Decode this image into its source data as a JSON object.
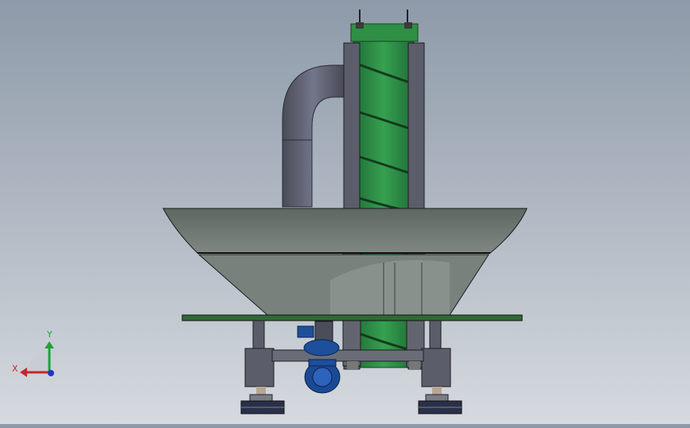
{
  "viewport": {
    "name": "3D model view",
    "background_top": "#8e9aa9",
    "background_bottom": "#d6dadf"
  },
  "model": {
    "tower_color": "#2e8a45",
    "frame_color": "#5b5e6a",
    "hopper_color": "#6e7770",
    "motor_color": "#1d4f9c"
  },
  "triad": {
    "x_label": "X",
    "y_label": "Y",
    "x_color": "#c0282b",
    "y_color": "#1fa23a",
    "z_color": "#2234c8"
  }
}
